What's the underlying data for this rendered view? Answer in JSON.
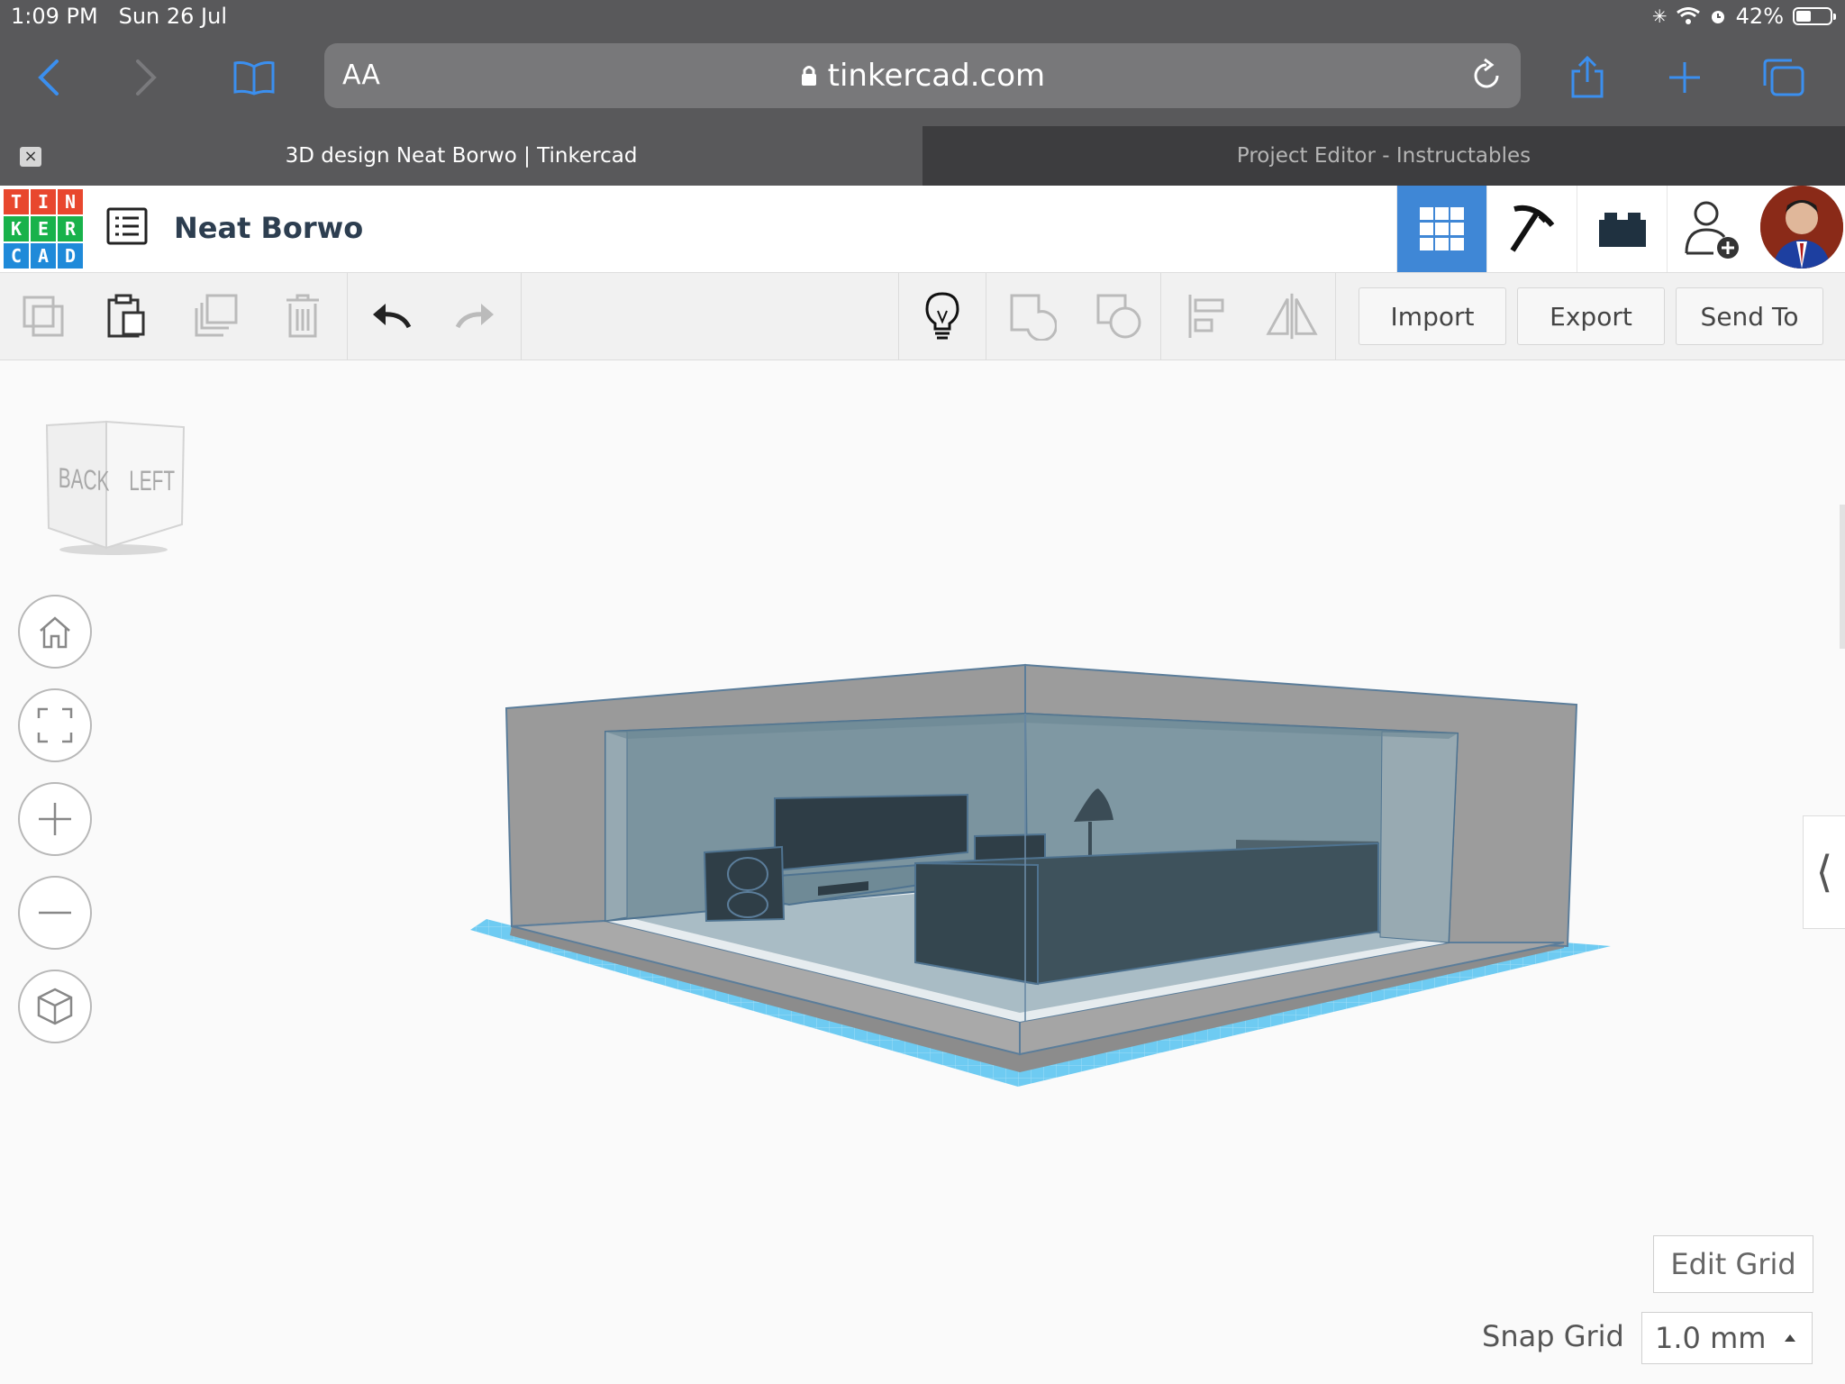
{
  "status": {
    "time": "1:09 PM",
    "date": "Sun 26 Jul",
    "battery": "42%"
  },
  "browser": {
    "text_size_label": "AA",
    "url": "tinkercad.com",
    "tabs": [
      {
        "label": "3D design Neat Borwo | Tinkercad"
      },
      {
        "label": "Project Editor - Instructables"
      }
    ]
  },
  "app": {
    "logo_letters": [
      "T",
      "I",
      "N",
      "K",
      "E",
      "R",
      "C",
      "A",
      "D"
    ],
    "logo_colors": [
      "#e8472e",
      "#e8472e",
      "#e8472e",
      "#19b24b",
      "#19b24b",
      "#19b24b",
      "#1f8ad9",
      "#1f8ad9",
      "#1f8ad9"
    ],
    "project_title": "Neat Borwo",
    "accent": "#3f87d6"
  },
  "toolbar": {
    "import_label": "Import",
    "export_label": "Export",
    "send_to_label": "Send To"
  },
  "viewcube": {
    "back_label": "BACK",
    "left_label": "LEFT"
  },
  "workspace": {
    "edit_grid_label": "Edit Grid",
    "snap_grid_label": "Snap Grid",
    "snap_grid_value": "1.0 mm"
  }
}
